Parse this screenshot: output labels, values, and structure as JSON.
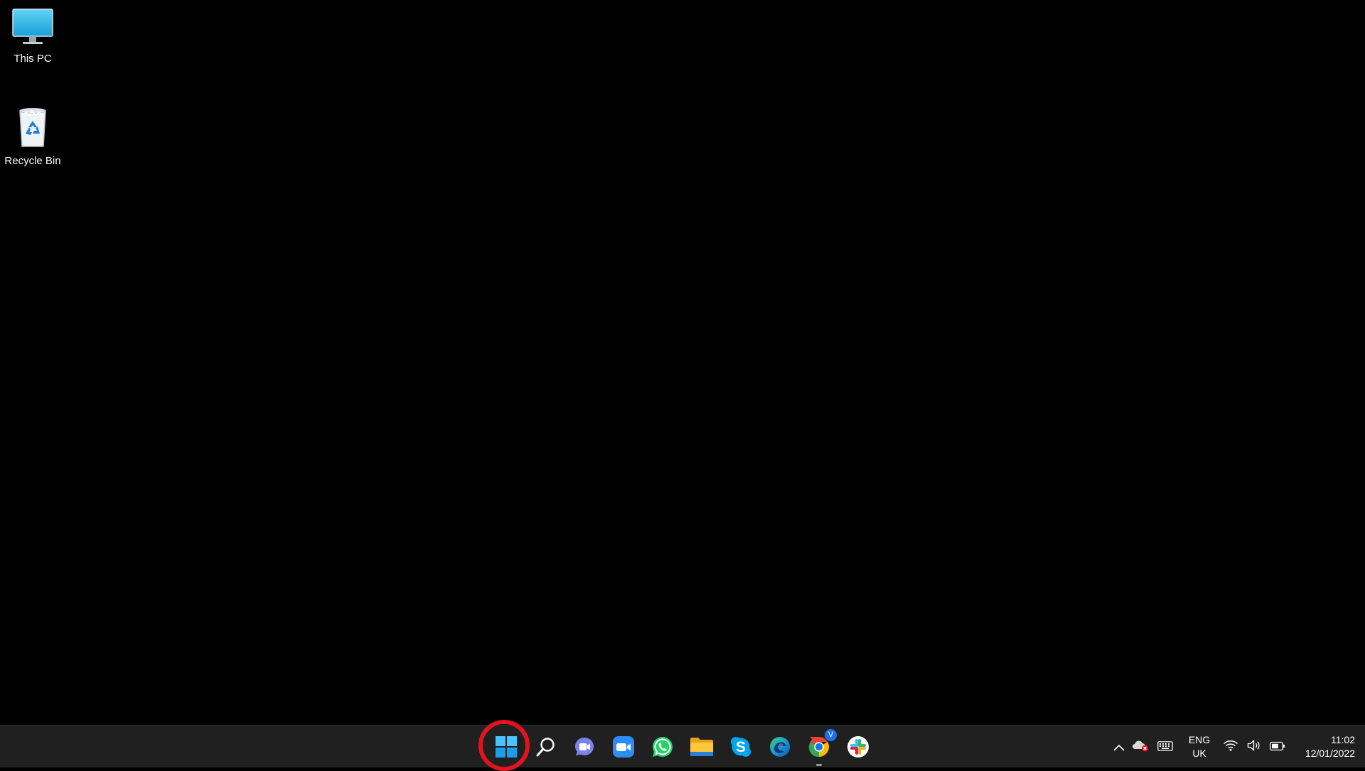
{
  "desktop": {
    "icons": [
      {
        "label": "This PC",
        "icon": "this-pc-icon"
      },
      {
        "label": "Recycle Bin",
        "icon": "recycle-bin-icon"
      }
    ]
  },
  "taskbar": {
    "pinned": [
      {
        "name": "Start",
        "icon": "windows-start-icon",
        "highlighted": true
      },
      {
        "name": "Search",
        "icon": "search-icon"
      },
      {
        "name": "Teams Chat",
        "icon": "teams-chat-icon"
      },
      {
        "name": "Zoom",
        "icon": "zoom-icon"
      },
      {
        "name": "WhatsApp",
        "icon": "whatsapp-icon"
      },
      {
        "name": "File Explorer",
        "icon": "file-explorer-icon"
      },
      {
        "name": "Skype",
        "icon": "skype-icon"
      },
      {
        "name": "Microsoft Edge",
        "icon": "edge-icon"
      },
      {
        "name": "Google Chrome",
        "icon": "chrome-icon",
        "running": true,
        "badge": "V"
      },
      {
        "name": "Slack",
        "icon": "slack-icon"
      }
    ],
    "tray": {
      "icons": [
        "chevron-up-icon",
        "onedrive-error-icon",
        "keyboard-icon",
        "wifi-icon",
        "volume-icon",
        "battery-icon"
      ],
      "language": {
        "line1": "ENG",
        "line2": "UK"
      },
      "clock": {
        "time": "11:02",
        "date": "12/01/2022"
      }
    },
    "colors": {
      "background": "#202020",
      "highlight_ring": "#e0141e",
      "accent": "#0078d4"
    }
  }
}
